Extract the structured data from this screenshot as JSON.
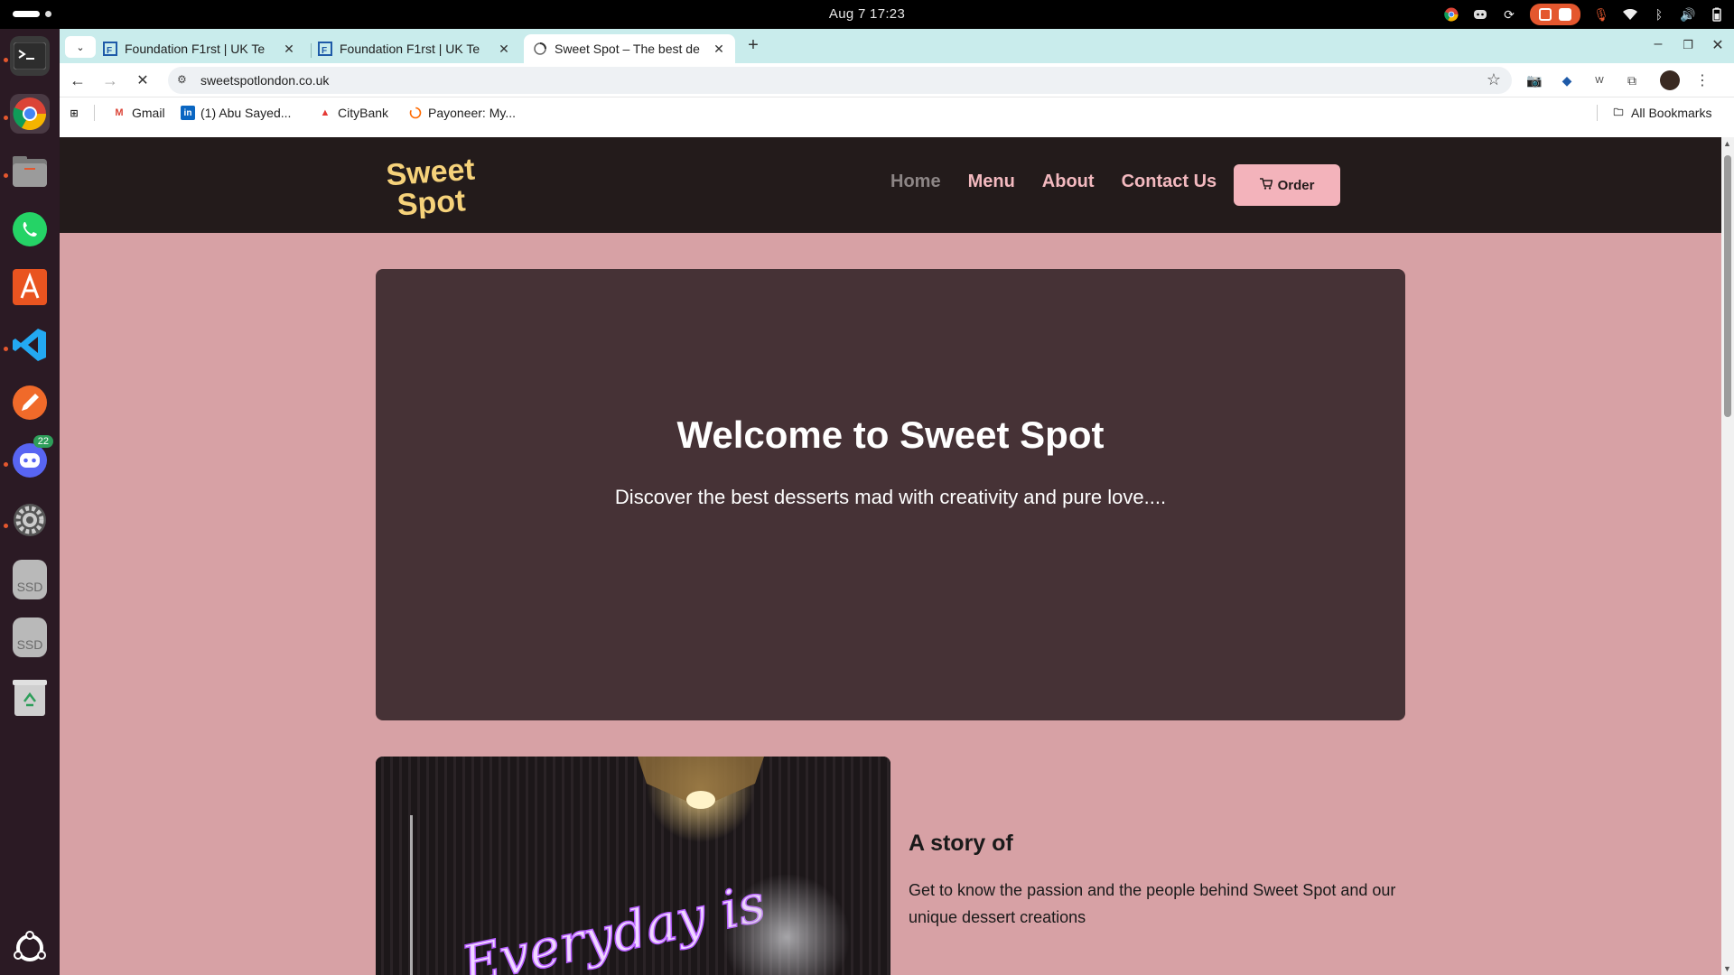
{
  "os": {
    "clock": "Aug 7  17:23"
  },
  "dock": {
    "items": [
      {
        "name": "terminal"
      },
      {
        "name": "chrome"
      },
      {
        "name": "files"
      },
      {
        "name": "whatsapp"
      },
      {
        "name": "app-center"
      },
      {
        "name": "vscode"
      },
      {
        "name": "drawing-app"
      },
      {
        "name": "discord",
        "badge": "22"
      },
      {
        "name": "settings"
      },
      {
        "name": "ssd-drive-1",
        "label": "SSD"
      },
      {
        "name": "ssd-drive-2",
        "label": "SSD"
      },
      {
        "name": "trash"
      },
      {
        "name": "show-apps"
      }
    ]
  },
  "browser": {
    "tabs": [
      {
        "title": "Foundation F1rst | UK Te",
        "active": false
      },
      {
        "title": "Foundation F1rst | UK Te",
        "active": false
      },
      {
        "title": "Sweet Spot – The best de",
        "active": true
      }
    ],
    "url": "sweetspotlondon.co.uk",
    "bookmarks": [
      {
        "label": "Gmail"
      },
      {
        "label": "(1) Abu Sayed..."
      },
      {
        "label": "CityBank"
      },
      {
        "label": "Payoneer: My..."
      }
    ],
    "all_bookmarks": "All Bookmarks"
  },
  "site": {
    "logo_text": [
      "Sweet",
      "Spot"
    ],
    "nav": [
      "Home",
      "Menu",
      "About",
      "Contact Us"
    ],
    "order_label": "Order",
    "hero_title": "Welcome to Sweet Spot",
    "hero_subtitle": "Discover the best desserts mad with creativity and pure love....",
    "neon_text": "Everyday is",
    "story_title": "A story of",
    "story_text": "Get to know the passion and the people behind Sweet Spot and our unique dessert creations"
  },
  "colors": {
    "page_bg": "#d7a1a5",
    "header_bg": "#231b1b",
    "hero_bg": "#463236",
    "nav_link": "#f3b9bf",
    "order_button": "#f3b3bb",
    "logo": "#f6d27a"
  }
}
